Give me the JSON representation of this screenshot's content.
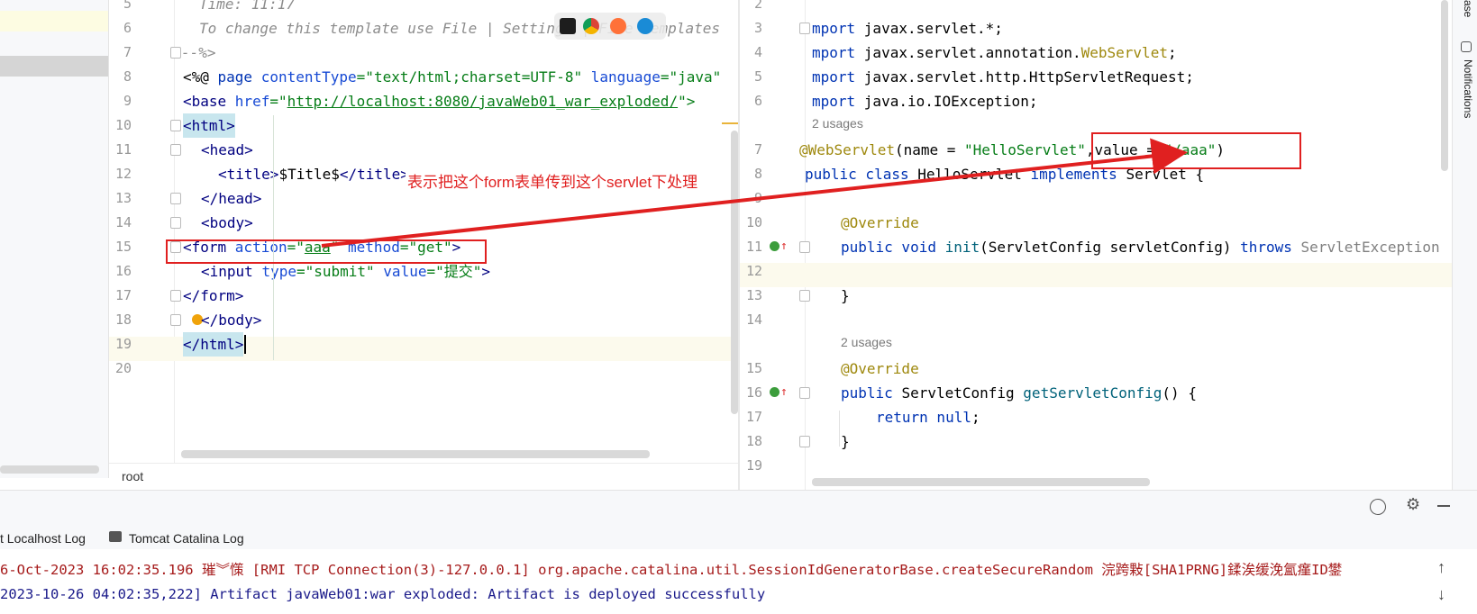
{
  "left_editor": {
    "lines": [
      {
        "n": "5",
        "text": "Time: 11:17"
      },
      {
        "n": "6",
        "text": "To change this template use File | Settings | File Templates"
      },
      {
        "n": "7",
        "text": "--%>"
      },
      {
        "n": "8",
        "p1": "<%@ ",
        "p2": "page ",
        "p3": "contentType",
        "p4": "=\"text/html;charset=UTF-8\" ",
        "p5": "language",
        "p6": "=\"java\""
      },
      {
        "n": "9",
        "p1": "<base ",
        "p2": "href",
        "p3": "=\"",
        "p4": "http://localhost:8080/javaWeb01_war_exploded/",
        "p5": "\">"
      },
      {
        "n": "10",
        "p1": "<html>"
      },
      {
        "n": "11",
        "p1": "<head>"
      },
      {
        "n": "12",
        "p1": "<title>",
        "p2": "$Title$",
        "p3": "</title>"
      },
      {
        "n": "13",
        "p1": "</head>"
      },
      {
        "n": "14",
        "p1": "<body>"
      },
      {
        "n": "15",
        "p1": "<form ",
        "p2": "action",
        "p3": "=\"",
        "p4": "aaa",
        "p5": "\" ",
        "p6": "method",
        "p7": "=\"get\"",
        "p8": ">"
      },
      {
        "n": "16",
        "p1": "<input ",
        "p2": "type",
        "p3": "=\"submit\" ",
        "p4": "value",
        "p5": "=\"提交\"",
        "p6": ">"
      },
      {
        "n": "17",
        "p1": "</form>"
      },
      {
        "n": "18",
        "p1": "</body>"
      },
      {
        "n": "19",
        "p1": "</html>"
      },
      {
        "n": "20"
      }
    ],
    "breadcrumb": "root"
  },
  "annotation": {
    "note": "表示把这个form表单传到这个servlet下处理",
    "color": "#e02020"
  },
  "right_editor": {
    "lines": [
      {
        "n": "2"
      },
      {
        "n": "3",
        "p1": "mport ",
        "p2": "javax.servlet.*;"
      },
      {
        "n": "4",
        "p1": "mport ",
        "p2": "javax.servlet.annotation.",
        "p3": "WebServlet",
        ";": ";"
      },
      {
        "n": "5",
        "p1": "mport ",
        "p2": "javax.servlet.http.HttpServletRequest;"
      },
      {
        "n": "6",
        "p1": "mport ",
        "p2": "java.io.IOException;"
      },
      {
        "usage": "2 usages"
      },
      {
        "n": "7",
        "p1": "@WebServlet",
        "p2": "(name = ",
        "p3": "\"HelloServlet\"",
        "p4": ",value = ",
        "p5": "\"/aaa\"",
        "p6": ")"
      },
      {
        "n": "8",
        "p1": "public class ",
        "p2": "HelloServlet ",
        "p3": "implements ",
        "p4": "Servlet {"
      },
      {
        "n": "9"
      },
      {
        "n": "10",
        "p1": "@Override"
      },
      {
        "n": "11",
        "p1": "public void ",
        "p2": "init",
        "p3": "(ServletConfig servletConfig) ",
        "p4": "throws ",
        "p5": "ServletException"
      },
      {
        "n": "12"
      },
      {
        "n": "13",
        "p1": "}"
      },
      {
        "n": "14"
      },
      {
        "usage": "2 usages"
      },
      {
        "n": "15",
        "p1": "@Override"
      },
      {
        "n": "16",
        "p1": "public ",
        "p2": "ServletConfig ",
        "p3": "getServletConfig",
        "p4": "() {"
      },
      {
        "n": "17",
        "p1": "return null",
        ";": ";"
      },
      {
        "n": "18",
        "p1": "}"
      },
      {
        "n": "19"
      }
    ],
    "notifications_label": "Notifications",
    "edge_label": "ase"
  },
  "bottom_panel": {
    "tabs": [
      "t Localhost Log",
      "Tomcat Catalina Log"
    ],
    "log_lines": [
      "6-Oct-2023 16:02:35.196 璀︾憡 [RMI TCP Connection(3)-127.0.0.1] org.apache.catalina.util.SessionIdGeneratorBase.createSecureRandom 浣跨敤[SHA1PRNG]鍒涘缓浼氳瘽ID鐢",
      "2023-10-26 04:02:35,222] Artifact javaWeb01:war exploded: Artifact is deployed successfully"
    ]
  },
  "colors": {
    "accent_red": "#e02020",
    "tag_blue": "#000080",
    "string_green": "#067d17",
    "keyword_blue": "#0033b3",
    "annotation_olive": "#9e880d",
    "log_red": "#a61b1b",
    "log_blue": "#1a1a8a"
  }
}
